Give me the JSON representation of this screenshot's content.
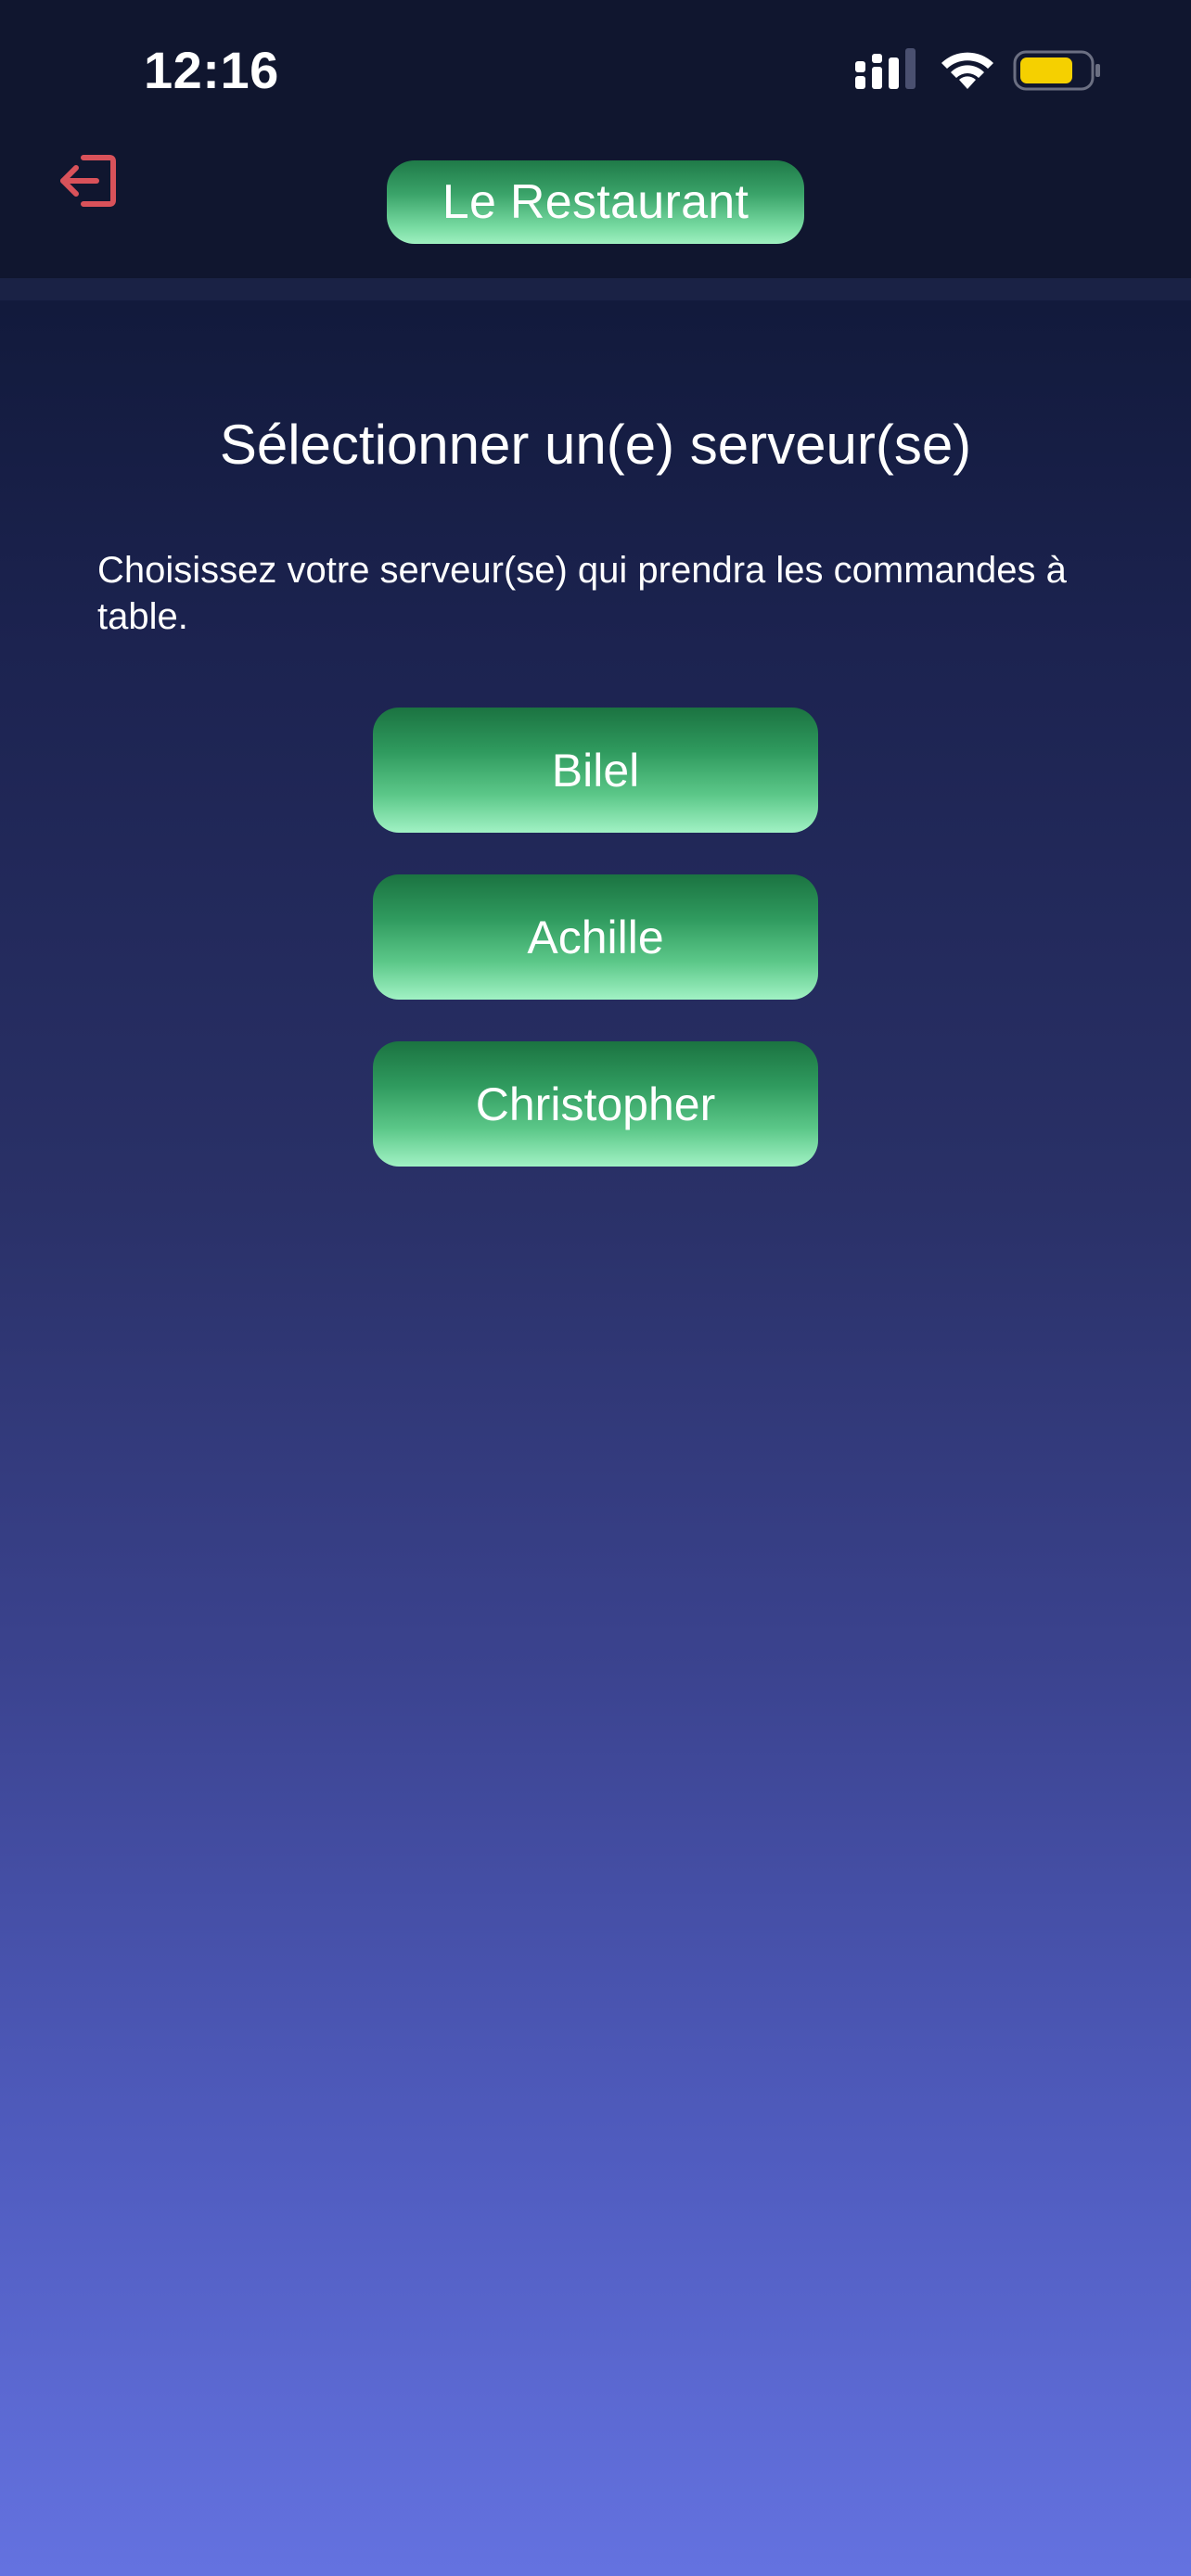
{
  "status_bar": {
    "time": "12:16",
    "icons": [
      "cellular-signal-icon",
      "wifi-icon",
      "battery-icon"
    ],
    "battery_color": "#f5d000"
  },
  "header": {
    "title": "Le Restaurant",
    "back_icon": "logout-icon",
    "back_icon_color": "#d9525a"
  },
  "main": {
    "heading": "Sélectionner un(e) serveur(se)",
    "description": "Choisissez votre serveur(se) qui prendra les commandes à table.",
    "servers": [
      {
        "name": "Bilel"
      },
      {
        "name": "Achille"
      },
      {
        "name": "Christopher"
      }
    ]
  },
  "colors": {
    "accent_green": "#3aa369",
    "background_top": "#101632",
    "background_bottom": "#6472e0"
  }
}
